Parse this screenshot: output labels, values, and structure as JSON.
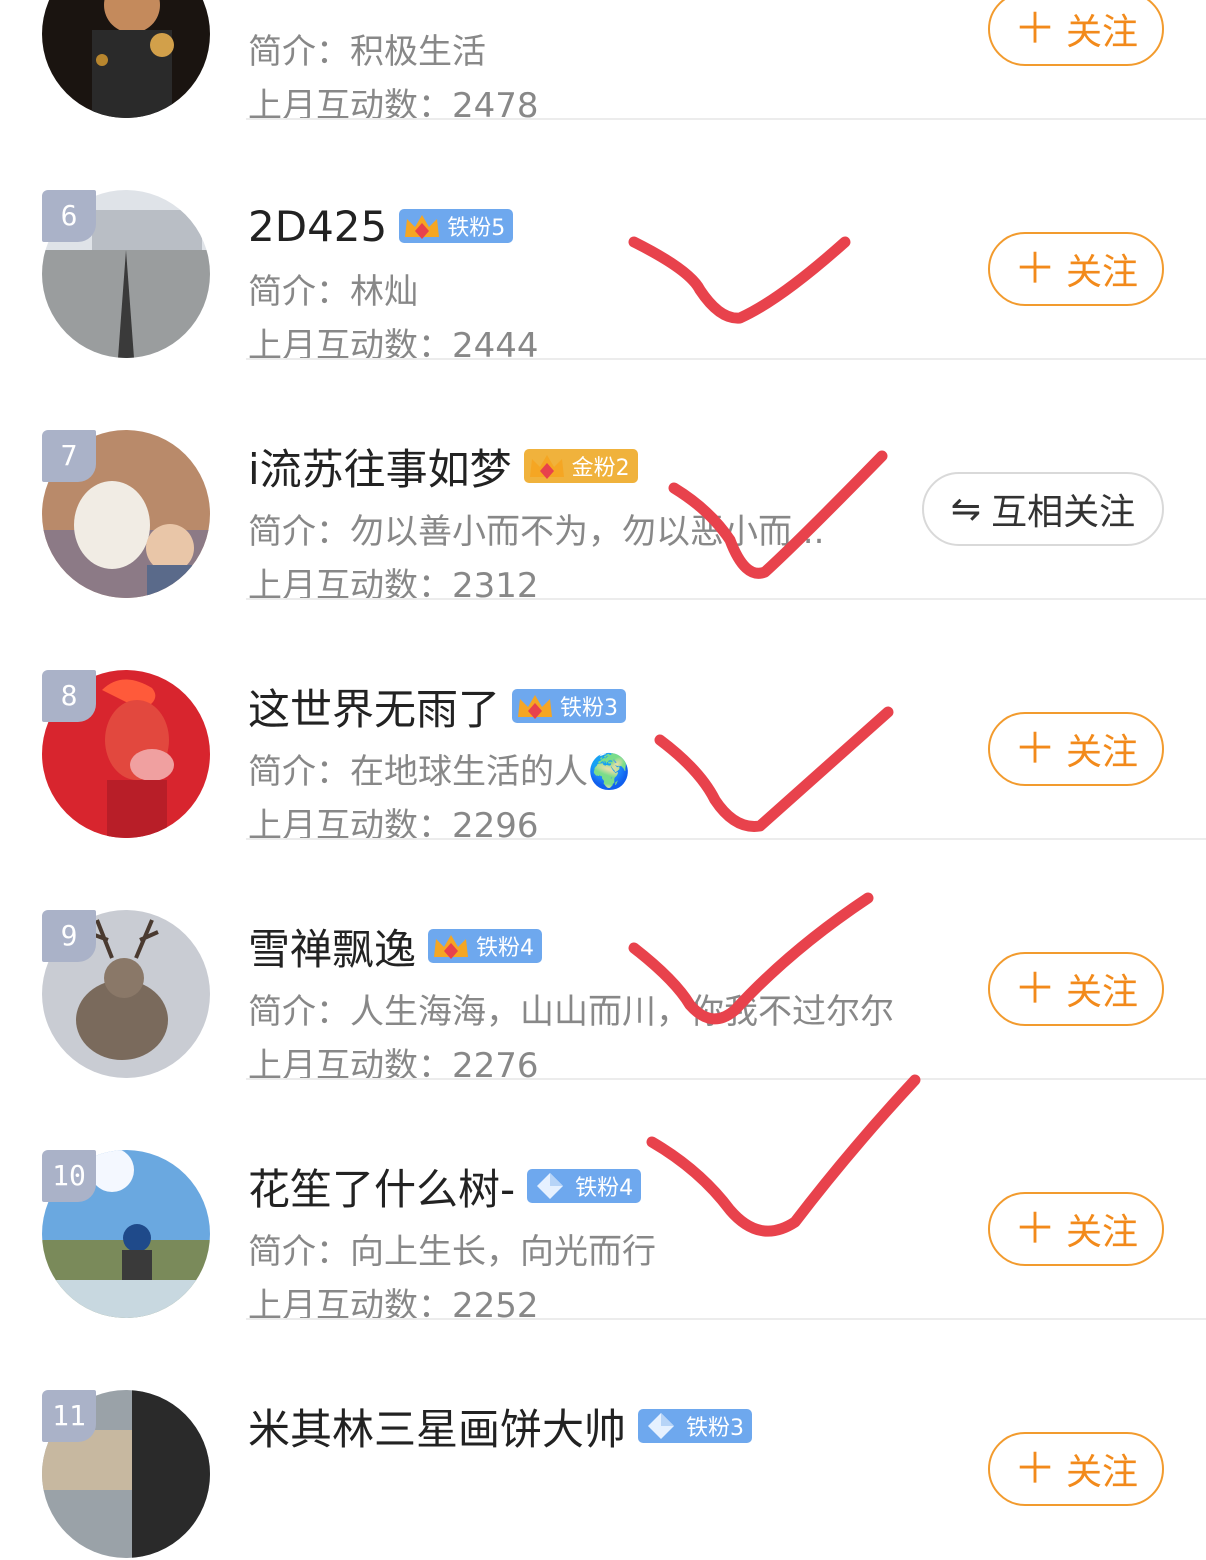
{
  "list": [
    {
      "rank": "",
      "name": "",
      "badge": null,
      "bio_label": "简介：",
      "bio": "积极生活",
      "stat_label": "上月互动数：",
      "stat": "2478",
      "button": "关注",
      "button_type": "follow"
    },
    {
      "rank": "6",
      "name": "2D425",
      "badge": {
        "kind": "iron",
        "text": "铁粉5"
      },
      "bio_label": "简介：",
      "bio": "林灿",
      "stat_label": "上月互动数：",
      "stat": "2444",
      "button": "关注",
      "button_type": "follow"
    },
    {
      "rank": "7",
      "name": "i流苏往事如梦",
      "badge": {
        "kind": "gold",
        "text": "金粉2"
      },
      "bio_label": "简介：",
      "bio": "勿以善小而不为，勿以恶小而...",
      "stat_label": "上月互动数：",
      "stat": "2312",
      "button": "互相关注",
      "button_type": "mutual"
    },
    {
      "rank": "8",
      "name": "这世界无雨了",
      "badge": {
        "kind": "iron",
        "text": "铁粉3"
      },
      "bio_label": "简介：",
      "bio": "在地球生活的人🌍",
      "stat_label": "上月互动数：",
      "stat": "2296",
      "button": "关注",
      "button_type": "follow"
    },
    {
      "rank": "9",
      "name": "雪禅飘逸",
      "badge": {
        "kind": "iron",
        "text": "铁粉4"
      },
      "bio_label": "简介：",
      "bio": "人生海海，山山而川，你我不过尔尔",
      "stat_label": "上月互动数：",
      "stat": "2276",
      "button": "关注",
      "button_type": "follow"
    },
    {
      "rank": "10",
      "name": "花笙了什么树-",
      "badge": {
        "kind": "diamond",
        "text": "铁粉4"
      },
      "bio_label": "简介：",
      "bio": "向上生长，向光而行",
      "stat_label": "上月互动数：",
      "stat": "2252",
      "button": "关注",
      "button_type": "follow"
    },
    {
      "rank": "11",
      "name": "米其林三星画饼大帅",
      "badge": {
        "kind": "diamond",
        "text": "铁粉3"
      },
      "bio_label": "简介：",
      "bio": "",
      "stat_label": "",
      "stat": "",
      "button": "关注",
      "button_type": "follow"
    }
  ],
  "icons": {
    "follow_plus": "plus-icon",
    "mutual": "swap-arrows-icon",
    "crown": "crown-badge-icon",
    "diamond": "diamond-badge-icon"
  },
  "colors": {
    "accent": "#f28a1b",
    "iron_badge": "#6ea8ee",
    "gold_badge": "#f0b23c",
    "annotation": "#e8424c"
  },
  "annotations": {
    "check_marks": 5
  }
}
